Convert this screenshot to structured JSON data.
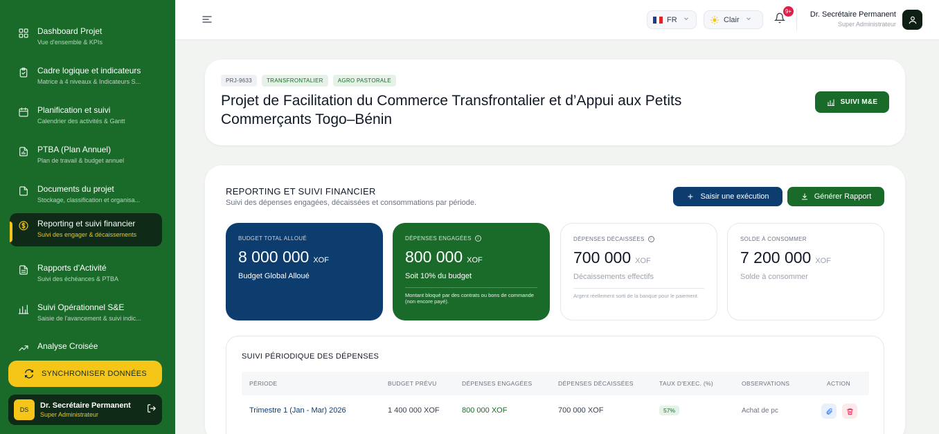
{
  "sidebar": {
    "items": [
      {
        "title": "Dashboard Projet",
        "sub": "Vue d'ensemble & KPIs",
        "icon": "grid-icon"
      },
      {
        "title": "Cadre logique et indicateurs",
        "sub": "Matrice à 4 niveaux & Indicateurs S...",
        "icon": "clipboard-check-icon"
      },
      {
        "title": "Planification et suivi",
        "sub": "Calendrier des activités & Gantt",
        "icon": "calendar-icon"
      },
      {
        "title": "PTBA (Plan Annuel)",
        "sub": "Plan de travail & budget annuel",
        "icon": "file-chart-icon"
      },
      {
        "title": "Documents du projet",
        "sub": "Stockage, classification et organisa...",
        "icon": "file-icon"
      },
      {
        "title": "Reporting et suivi financier",
        "sub": "Suivi des engager & décaissements",
        "icon": "dollar-circle-icon"
      },
      {
        "title": "Rapports d'Activité",
        "sub": "Suivi des échéances & PTBA",
        "icon": "file-text-icon"
      },
      {
        "title": "Suivi Opérationnel S&E",
        "sub": "Saisie de l'avancement & suivi indic...",
        "icon": "bar-chart-icon"
      },
      {
        "title": "Analyse Croisée",
        "sub": "",
        "icon": "trend-icon"
      }
    ],
    "sync_label": "SYNCHRONISER DONNÉES",
    "user": {
      "initials": "DS",
      "name": "Dr. Secrétaire Permanent",
      "role": "Super Administrateur"
    }
  },
  "topbar": {
    "lang": "FR",
    "theme": "Clair",
    "notif_count": "9+",
    "user_name": "Dr. Secrétaire Permanent",
    "user_role": "Super Administrateur"
  },
  "project": {
    "tags": [
      "PRJ-9633",
      "TRANSFRONTALIER",
      "AGRO PASTORALE"
    ],
    "title": "Projet de Facilitation du Commerce Transfrontalier et d’Appui aux Petits Commerçants Togo–Bénin",
    "suivi_label": "SUIVI M&E"
  },
  "report": {
    "title": "REPORTING ET SUIVI FINANCIER",
    "subtitle": "Suivi des dépenses engagées, décaissées et consommations par période.",
    "btn_saisir": "Saisir une exécution",
    "btn_generer": "Générer Rapport",
    "kpis": [
      {
        "label": "BUDGET TOTAL ALLOUÉ",
        "value": "8 000 000",
        "currency": "XOF",
        "desc": "Budget Global Alloué",
        "note": ""
      },
      {
        "label": "DÉPENSES ENGAGÉES",
        "value": "800 000",
        "currency": "XOF",
        "desc": "Soit 10% du budget",
        "note": "Montant bloqué par des contrats ou bons de commande (non encore payé)."
      },
      {
        "label": "DÉPENSES DÉCAISSÉES",
        "value": "700 000",
        "currency": "XOF",
        "desc": "Décaissements effectifs",
        "note": "Argent réellement sorti de la banque pour le paiement."
      },
      {
        "label": "SOLDE À CONSOMMER",
        "value": "7 200 000",
        "currency": "XOF",
        "desc": "Solde à consommer",
        "note": ""
      }
    ],
    "periodic": {
      "title": "SUIVI PÉRIODIQUE DES DÉPENSES",
      "headers": [
        "PÉRIODE",
        "BUDGET PRÉVU",
        "DÉPENSES ENGAGÉES",
        "DÉPENSES DÉCAISSÉES",
        "TAUX D'EXEC. (%)",
        "OBSERVATIONS",
        "ACTION"
      ],
      "rows": [
        {
          "period": "Trimestre 1 (Jan - Mar) 2026",
          "budget": "1 400 000 XOF",
          "engaged": "800 000 XOF",
          "disbursed": "700 000 XOF",
          "rate": "57%",
          "obs": "Achat de pc"
        }
      ]
    }
  }
}
